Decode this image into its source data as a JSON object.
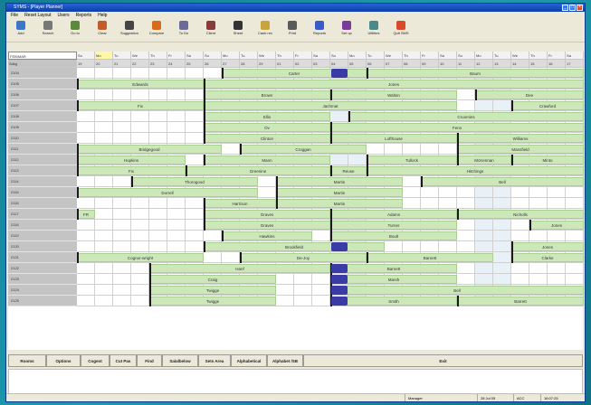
{
  "window": {
    "title": "SYMS - [Player Planner]"
  },
  "menu": [
    "File",
    "Reset Layout",
    "Users",
    "Reports",
    "Help"
  ],
  "toolbar": [
    {
      "label": "Add",
      "icon": "add-icon",
      "color": "#3a77c9"
    },
    {
      "label": "Search",
      "icon": "search-icon",
      "color": "#777777"
    },
    {
      "label": "Go to",
      "icon": "goto-icon",
      "color": "#5a8a3a"
    },
    {
      "label": "Clear",
      "icon": "clear-icon",
      "color": "#c25a2a"
    },
    {
      "label": "Suggestion",
      "icon": "suggestion-icon",
      "color": "#444444"
    },
    {
      "label": "Compare",
      "icon": "compare-icon",
      "color": "#d86a1a"
    },
    {
      "label": "To Do",
      "icon": "todo-icon",
      "color": "#6b6b9a"
    },
    {
      "label": "Client",
      "icon": "client-icon",
      "color": "#8a3a3a"
    },
    {
      "label": "Sheet",
      "icon": "sheet-icon",
      "color": "#333333"
    },
    {
      "label": "Cash rec",
      "icon": "cash-icon",
      "color": "#c9a43a"
    },
    {
      "label": "Print",
      "icon": "print-icon",
      "color": "#5a5a5a"
    },
    {
      "label": "Reports",
      "icon": "reports-icon",
      "color": "#3a5ac9"
    },
    {
      "label": "Set up",
      "icon": "setup-icon",
      "color": "#7a3a9a"
    },
    {
      "label": "Utilities",
      "icon": "utilities-icon",
      "color": "#4a8a8a"
    },
    {
      "label": "Quit SMS",
      "icon": "quit-icon",
      "color": "#d84a2a"
    }
  ],
  "grid": {
    "date_select": "FEB/MAR",
    "corner_label": "Sdkg",
    "day_names": [
      "Su",
      "Mo",
      "Tu",
      "We",
      "Th",
      "Fr",
      "Sa",
      "Su",
      "Mo",
      "Tu",
      "We",
      "Th",
      "Fr",
      "Sa",
      "Su",
      "Mo",
      "Tu",
      "We",
      "Th",
      "Fr",
      "Sa",
      "Su",
      "Mo",
      "Tu",
      "We",
      "Th",
      "Fr",
      "Sa"
    ],
    "day_numbers": [
      "19",
      "20",
      "21",
      "22",
      "23",
      "24",
      "25",
      "26",
      "27",
      "28",
      "29",
      "01",
      "02",
      "03",
      "04",
      "05",
      "06",
      "07",
      "08",
      "09",
      "10",
      "11",
      "12",
      "13",
      "14",
      "15",
      "16",
      "17"
    ],
    "rows": [
      {
        "label": "2104",
        "bars": [
          {
            "s": 8,
            "e": 16,
            "t": "Carter"
          },
          {
            "s": 16,
            "e": 28,
            "t": "Baum"
          }
        ]
      },
      {
        "label": "2105",
        "bars": [
          {
            "s": 0,
            "e": 7,
            "t": "Edwards"
          },
          {
            "s": 7,
            "e": 28,
            "t": "Jones"
          }
        ]
      },
      {
        "label": "2106",
        "bars": [
          {
            "s": 7,
            "e": 14,
            "t": "Brown"
          },
          {
            "s": 14,
            "e": 21,
            "t": "Walton"
          },
          {
            "s": 22,
            "e": 28,
            "t": "Dee"
          }
        ]
      },
      {
        "label": "2107",
        "bars": [
          {
            "s": 0,
            "e": 7,
            "t": "Fix"
          },
          {
            "s": 7,
            "e": 21,
            "t": "Jachmat"
          },
          {
            "s": 24,
            "e": 28,
            "t": "Crawfurd"
          }
        ]
      },
      {
        "label": "2108",
        "bars": [
          {
            "s": 7,
            "e": 14,
            "t": "Ellis"
          },
          {
            "s": 15,
            "e": 28,
            "t": "Cruomins"
          }
        ]
      },
      {
        "label": "2109",
        "bars": [
          {
            "s": 7,
            "e": 14,
            "t": "Ov"
          },
          {
            "s": 14,
            "e": 28,
            "t": "Fenn"
          }
        ]
      },
      {
        "label": "2110",
        "bars": [
          {
            "s": 7,
            "e": 14,
            "t": "Clinton"
          },
          {
            "s": 14,
            "e": 21,
            "t": "Lofthouse"
          },
          {
            "s": 21,
            "e": 28,
            "t": "Williams"
          }
        ]
      },
      {
        "label": "2111",
        "bars": [
          {
            "s": 0,
            "e": 8,
            "t": "Bridgegood"
          },
          {
            "s": 9,
            "e": 16,
            "t": "Croggan"
          },
          {
            "s": 21,
            "e": 28,
            "t": "Mansfield"
          }
        ]
      },
      {
        "label": "2112",
        "bars": [
          {
            "s": 0,
            "e": 6,
            "t": "Hopkins"
          },
          {
            "s": 7,
            "e": 14,
            "t": "Mann"
          },
          {
            "s": 16,
            "e": 21,
            "t": "Tullock"
          },
          {
            "s": 21,
            "e": 24,
            "t": "McKennan"
          },
          {
            "s": 24,
            "e": 28,
            "t": "Minto"
          }
        ]
      },
      {
        "label": "2113",
        "bars": [
          {
            "s": 0,
            "e": 6,
            "t": "Fix"
          },
          {
            "s": 6,
            "e": 14,
            "t": "Greenine"
          },
          {
            "s": 14,
            "e": 16,
            "t": "Reuse"
          },
          {
            "s": 16,
            "e": 28,
            "t": "Hitchings"
          }
        ]
      },
      {
        "label": "2114",
        "bars": [
          {
            "s": 3,
            "e": 10,
            "t": "Thorogood"
          },
          {
            "s": 11,
            "e": 18,
            "t": "Martin"
          },
          {
            "s": 19,
            "e": 28,
            "t": "Bell"
          }
        ]
      },
      {
        "label": "2115",
        "bars": [
          {
            "s": 0,
            "e": 10,
            "t": "Dorrell"
          },
          {
            "s": 11,
            "e": 18,
            "t": "Martin"
          }
        ]
      },
      {
        "label": "2116",
        "bars": [
          {
            "s": 7,
            "e": 11,
            "t": "Harrison"
          },
          {
            "s": 11,
            "e": 18,
            "t": "Martin"
          }
        ]
      },
      {
        "label": "2117",
        "bars": [
          {
            "s": 0,
            "e": 1,
            "t": "FR"
          },
          {
            "s": 7,
            "e": 14,
            "t": "Graves"
          },
          {
            "s": 14,
            "e": 21,
            "t": "Adams"
          },
          {
            "s": 21,
            "e": 28,
            "t": "Nicholls"
          }
        ]
      },
      {
        "label": "2118",
        "bars": [
          {
            "s": 7,
            "e": 14,
            "t": "Graves"
          },
          {
            "s": 14,
            "e": 21,
            "t": "Turner"
          },
          {
            "s": 25,
            "e": 28,
            "t": "Jones"
          }
        ]
      },
      {
        "label": "2119",
        "bars": [
          {
            "s": 8,
            "e": 13,
            "t": "Hawkins"
          },
          {
            "s": 14,
            "e": 21,
            "t": "Boult"
          }
        ]
      },
      {
        "label": "2120",
        "bars": [
          {
            "s": 7,
            "e": 17,
            "t": "Brookfield"
          },
          {
            "s": 24,
            "e": 28,
            "t": "Jones"
          }
        ]
      },
      {
        "label": "2121",
        "bars": [
          {
            "s": 0,
            "e": 7,
            "t": "Cognor-wright"
          },
          {
            "s": 9,
            "e": 16,
            "t": "De-Joy"
          },
          {
            "s": 16,
            "e": 23,
            "t": "Barnett"
          },
          {
            "s": 24,
            "e": 28,
            "t": "Clarke"
          }
        ]
      },
      {
        "label": "2122",
        "bars": [
          {
            "s": 4,
            "e": 14,
            "t": "Hanf"
          },
          {
            "s": 14,
            "e": 21,
            "t": "Barnett"
          }
        ]
      },
      {
        "label": "2123",
        "bars": [
          {
            "s": 4,
            "e": 11,
            "t": "Craig"
          },
          {
            "s": 14,
            "e": 21,
            "t": "Marsh"
          }
        ]
      },
      {
        "label": "2124",
        "bars": [
          {
            "s": 4,
            "e": 11,
            "t": "Twigge"
          },
          {
            "s": 14,
            "e": 28,
            "t": "Bell"
          }
        ]
      },
      {
        "label": "2125",
        "bars": [
          {
            "s": 4,
            "e": 11,
            "t": "Twigge"
          },
          {
            "s": 14,
            "e": 21,
            "t": "Smith"
          },
          {
            "s": 21,
            "e": 28,
            "t": "Barrett"
          }
        ]
      }
    ]
  },
  "tabs": [
    "Rooms",
    "Options",
    "Cogent",
    "Cut Pas",
    "Find",
    "Salalbelow",
    "Sets Area",
    "Alphabetical",
    "Alphabet /SB",
    "Exit"
  ],
  "status": {
    "user": "Manager",
    "date": "28 Jul 05",
    "caps": "ACC",
    "time": "16:07:25"
  },
  "colors": {
    "booking": "#cde8b8",
    "row_header": "#c4c4c4",
    "accent": "#3b3ba8"
  }
}
